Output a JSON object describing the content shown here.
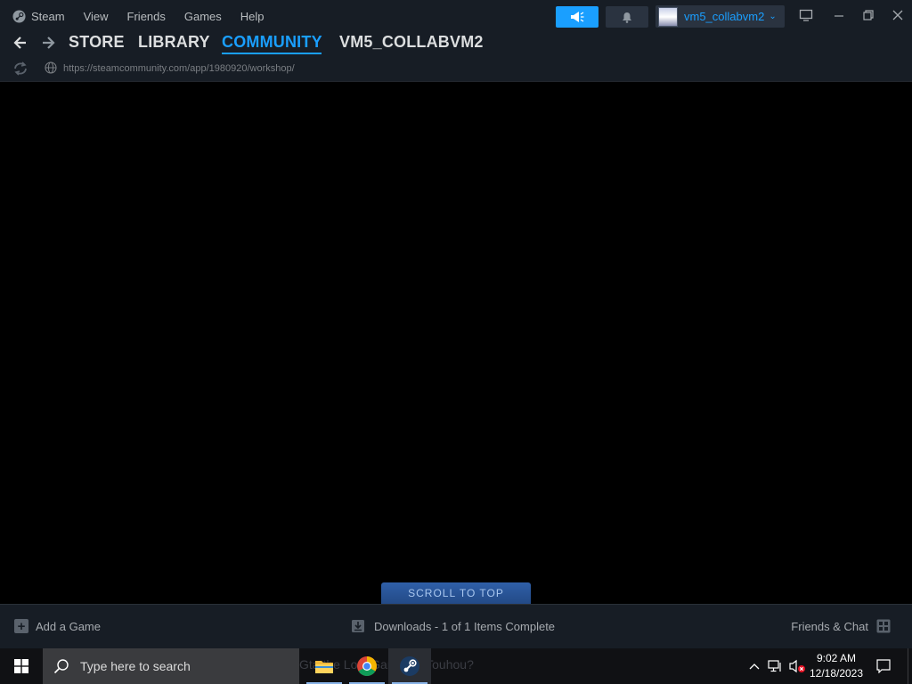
{
  "menu": {
    "items": [
      "Steam",
      "View",
      "Friends",
      "Games",
      "Help"
    ]
  },
  "account": {
    "name": "vm5_collabvm2",
    "chevron": "⌄"
  },
  "nav": {
    "tabs": [
      "STORE",
      "LIBRARY",
      "COMMUNITY",
      "VM5_COLLABVM2"
    ],
    "active_tab": "COMMUNITY",
    "url": "https://steamcommunity.com/app/1980920/workshop/"
  },
  "content": {
    "scroll_to_top_label": "SCROLL TO TOP"
  },
  "bottom_bar": {
    "add_game_label": "Add a Game",
    "downloads_label": "Downloads - 1 of 1 Items Complete",
    "friends_label": "Friends & Chat"
  },
  "taskbar": {
    "search_placeholder": "Type here to search",
    "ghost_text": "Gta the Lost Game for Touhou?",
    "apps": [
      "file-explorer-icon",
      "chrome-icon",
      "steam-icon"
    ],
    "active_app": "steam-icon",
    "time": "9:02 AM",
    "date": "12/18/2023"
  },
  "icons": {
    "back": "back-arrow-icon",
    "forward": "forward-arrow-icon",
    "reload": "reload-icon",
    "globe": "globe-icon",
    "announce": "megaphone-icon",
    "notification": "bell-icon",
    "big_picture": "monitor-icon",
    "minimize": "minimize-icon",
    "maximize": "restore-icon",
    "close": "close-icon"
  },
  "colors": {
    "accent": "#1a9fff",
    "titlebar_bg": "#171d25",
    "content_bg": "#000000",
    "scroll_btn": "#2f5fa8",
    "taskbar_bg": "#101114"
  }
}
